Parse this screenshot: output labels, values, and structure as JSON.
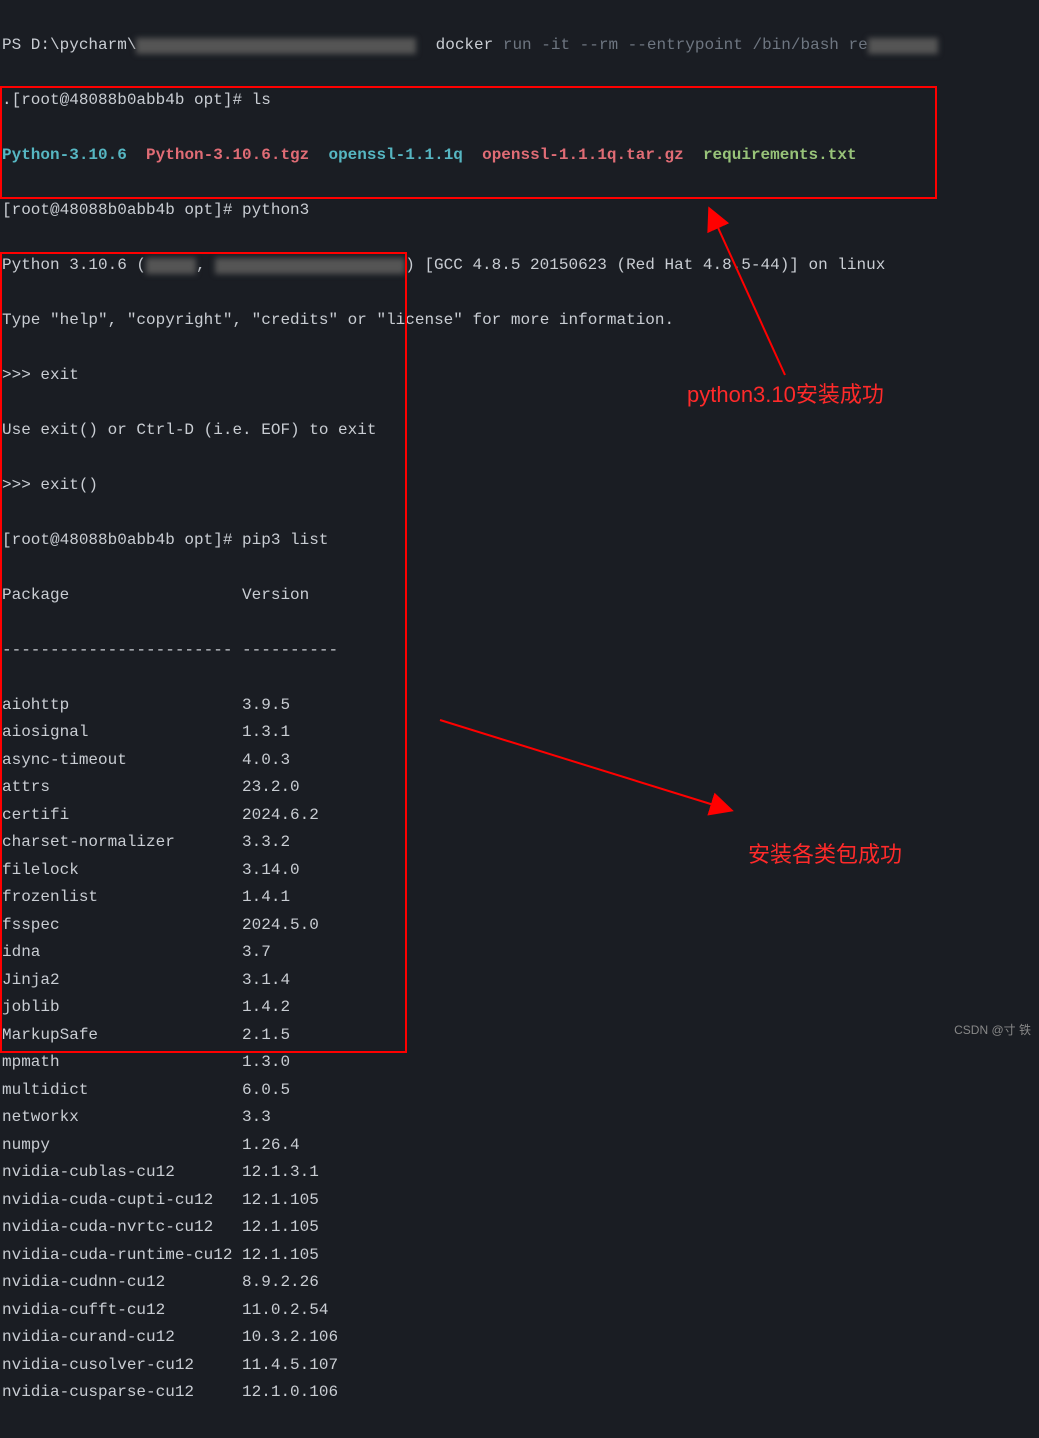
{
  "line1": {
    "prefix": "PS D:\\pycharm\\",
    "cmd_white": "docker",
    "cmd_gray": " run -it --rm --entrypoint /bin/bash re"
  },
  "line2": ".[root@48088b0abb4b opt]# ls",
  "files": {
    "f1": "Python-3.10.6",
    "f2": "Python-3.10.6.tgz",
    "f3": "openssl-1.1.1q",
    "f4": "openssl-1.1.1q.tar.gz",
    "f5": "requirements.txt"
  },
  "line4": "[root@48088b0abb4b opt]# python3",
  "line5a": "Python 3.10.6 (",
  "line5b": ") [GCC 4.8.5 20150623 (Red Hat 4.8.5-44)] on linux",
  "line6": "Type \"help\", \"copyright\", \"credits\" or \"license\" for more information.",
  "line7": ">>> exit",
  "line8": "Use exit() or Ctrl-D (i.e. EOF) to exit",
  "line9": ">>> exit()",
  "line10": "[root@48088b0abb4b opt]# pip3 list",
  "header": {
    "pkg": "Package",
    "ver": "Version"
  },
  "divider": "------------------------ ----------",
  "packages": [
    {
      "name": "aiohttp",
      "version": "3.9.5"
    },
    {
      "name": "aiosignal",
      "version": "1.3.1"
    },
    {
      "name": "async-timeout",
      "version": "4.0.3"
    },
    {
      "name": "attrs",
      "version": "23.2.0"
    },
    {
      "name": "certifi",
      "version": "2024.6.2"
    },
    {
      "name": "charset-normalizer",
      "version": "3.3.2"
    },
    {
      "name": "filelock",
      "version": "3.14.0"
    },
    {
      "name": "frozenlist",
      "version": "1.4.1"
    },
    {
      "name": "fsspec",
      "version": "2024.5.0"
    },
    {
      "name": "idna",
      "version": "3.7"
    },
    {
      "name": "Jinja2",
      "version": "3.1.4"
    },
    {
      "name": "joblib",
      "version": "1.4.2"
    },
    {
      "name": "MarkupSafe",
      "version": "2.1.5"
    },
    {
      "name": "mpmath",
      "version": "1.3.0"
    },
    {
      "name": "multidict",
      "version": "6.0.5"
    },
    {
      "name": "networkx",
      "version": "3.3"
    },
    {
      "name": "numpy",
      "version": "1.26.4"
    },
    {
      "name": "nvidia-cublas-cu12",
      "version": "12.1.3.1"
    },
    {
      "name": "nvidia-cuda-cupti-cu12",
      "version": "12.1.105"
    },
    {
      "name": "nvidia-cuda-nvrtc-cu12",
      "version": "12.1.105"
    },
    {
      "name": "nvidia-cuda-runtime-cu12",
      "version": "12.1.105"
    },
    {
      "name": "nvidia-cudnn-cu12",
      "version": "8.9.2.26"
    },
    {
      "name": "nvidia-cufft-cu12",
      "version": "11.0.2.54"
    },
    {
      "name": "nvidia-curand-cu12",
      "version": "10.3.2.106"
    },
    {
      "name": "nvidia-cusolver-cu12",
      "version": "11.4.5.107"
    },
    {
      "name": "nvidia-cusparse-cu12",
      "version": "12.1.0.106"
    }
  ],
  "annotations": {
    "a1": "python3.10安装成功",
    "a2": "安装各类包成功"
  },
  "watermark": "CSDN @寸 铁"
}
